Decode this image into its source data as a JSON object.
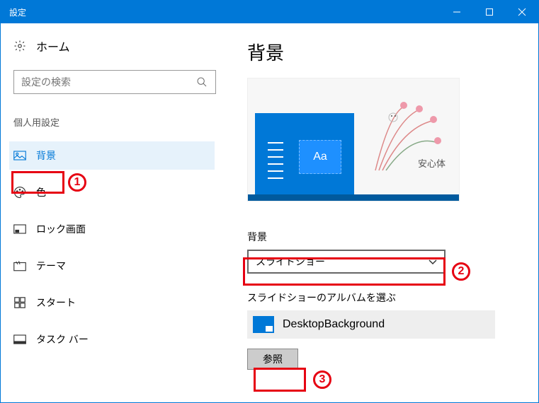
{
  "titlebar": {
    "title": "設定"
  },
  "sidebar": {
    "home": "ホーム",
    "search_placeholder": "設定の検索",
    "section": "個人用設定",
    "items": [
      {
        "label": "背景"
      },
      {
        "label": "色"
      },
      {
        "label": "ロック画面"
      },
      {
        "label": "テーマ"
      },
      {
        "label": "スタート"
      },
      {
        "label": "タスク バー"
      }
    ]
  },
  "main": {
    "title": "背景",
    "preview_sample": "Aa",
    "bg_label": "背景",
    "bg_value": "スライドショー",
    "album_label": "スライドショーのアルバムを選ぶ",
    "album_name": "DesktopBackground",
    "browse": "参照"
  },
  "callouts": {
    "c1": "1",
    "c2": "2",
    "c3": "3"
  }
}
